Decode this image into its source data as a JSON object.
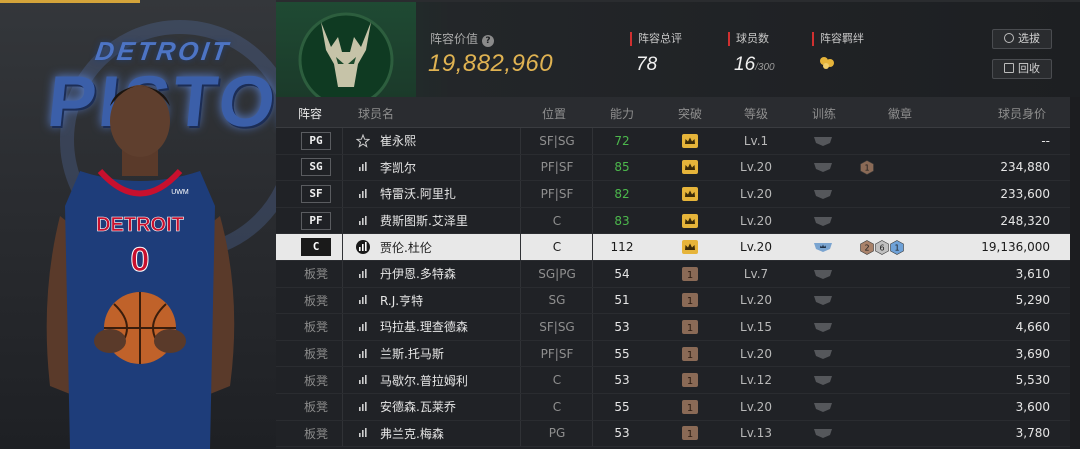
{
  "team_art": {
    "logo_small": "DETROIT",
    "logo_big": "PISTON"
  },
  "header": {
    "value_label": "阵容价值",
    "value": "19,882,960",
    "stats": [
      {
        "label": "阵容总评",
        "value": "78",
        "sub": ""
      },
      {
        "label": "球员数",
        "value": "16",
        "sub": "/300"
      },
      {
        "label": "阵容羁绊",
        "value": "",
        "sub": ""
      }
    ],
    "buttons": {
      "select": "选拔",
      "back": "回收"
    }
  },
  "columns": [
    "阵容",
    "球员名",
    "位置",
    "能力",
    "突破",
    "等级",
    "训练",
    "徽章",
    "球员身价"
  ],
  "rows": [
    {
      "slot": "PG",
      "bench": false,
      "icon": "star",
      "name": "崔永熙",
      "pos": "SF|SG",
      "ovr": "72",
      "ovr_green": true,
      "brk": "gold",
      "lv": "Lv.1",
      "badges": [],
      "price": "--"
    },
    {
      "slot": "SG",
      "bench": false,
      "icon": "bars",
      "name": "李凯尔",
      "pos": "PF|SF",
      "ovr": "85",
      "ovr_green": true,
      "brk": "gold",
      "lv": "Lv.20",
      "badges": [
        "1"
      ],
      "price": "234,880"
    },
    {
      "slot": "SF",
      "bench": false,
      "icon": "bars",
      "name": "特雷沃.阿里扎",
      "pos": "PF|SF",
      "ovr": "82",
      "ovr_green": true,
      "brk": "gold",
      "lv": "Lv.20",
      "badges": [],
      "price": "233,600"
    },
    {
      "slot": "PF",
      "bench": false,
      "icon": "bars",
      "name": "费斯图斯.艾泽里",
      "pos": "C",
      "ovr": "83",
      "ovr_green": true,
      "brk": "gold",
      "lv": "Lv.20",
      "badges": [],
      "price": "248,320"
    },
    {
      "slot": "C",
      "bench": false,
      "selected": true,
      "icon": "bars",
      "name": "贾伦.杜伦",
      "pos": "C",
      "ovr": "112",
      "ovr_green": false,
      "brk": "gold",
      "lv": "Lv.20",
      "badges": [
        "2",
        "6",
        "1"
      ],
      "price": "19,136,000"
    },
    {
      "slot": "板凳",
      "bench": true,
      "icon": "bars",
      "name": "丹伊恩.多特森",
      "pos": "SG|PG",
      "ovr": "54",
      "ovr_green": false,
      "brk": "brown",
      "lv": "Lv.7",
      "badges": [],
      "price": "3,610"
    },
    {
      "slot": "板凳",
      "bench": true,
      "icon": "bars",
      "name": "R.J.亨特",
      "pos": "SG",
      "ovr": "51",
      "ovr_green": false,
      "brk": "brown",
      "lv": "Lv.20",
      "badges": [],
      "price": "5,290"
    },
    {
      "slot": "板凳",
      "bench": true,
      "icon": "bars",
      "name": "玛拉基.理查德森",
      "pos": "SF|SG",
      "ovr": "53",
      "ovr_green": false,
      "brk": "brown",
      "lv": "Lv.15",
      "badges": [],
      "price": "4,660"
    },
    {
      "slot": "板凳",
      "bench": true,
      "icon": "bars",
      "name": "兰斯.托马斯",
      "pos": "PF|SF",
      "ovr": "55",
      "ovr_green": false,
      "brk": "brown",
      "lv": "Lv.20",
      "badges": [],
      "price": "3,690"
    },
    {
      "slot": "板凳",
      "bench": true,
      "icon": "bars",
      "name": "马歇尔.普拉姆利",
      "pos": "C",
      "ovr": "53",
      "ovr_green": false,
      "brk": "brown",
      "lv": "Lv.12",
      "badges": [],
      "price": "5,530"
    },
    {
      "slot": "板凳",
      "bench": true,
      "icon": "bars",
      "name": "安德森.瓦莱乔",
      "pos": "C",
      "ovr": "55",
      "ovr_green": false,
      "brk": "brown",
      "lv": "Lv.20",
      "badges": [],
      "price": "3,600"
    },
    {
      "slot": "板凳",
      "bench": true,
      "icon": "bars",
      "name": "弗兰克.梅森",
      "pos": "PG",
      "ovr": "53",
      "ovr_green": false,
      "brk": "brown",
      "lv": "Lv.13",
      "badges": [],
      "price": "3,780"
    }
  ],
  "player_art": {
    "jersey_text": "DETROIT",
    "jersey_number": "0",
    "sponsor": "UWM"
  }
}
